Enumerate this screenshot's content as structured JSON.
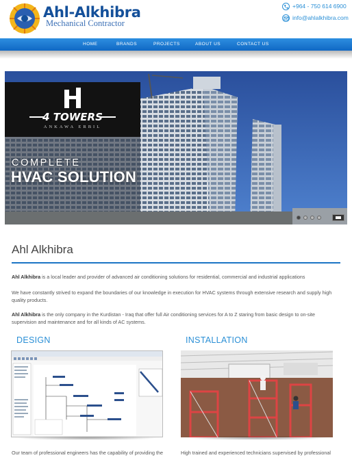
{
  "header": {
    "title": "Ahl-Alkhibra",
    "subtitle": "Mechanical Contractor",
    "phone": "+964 - 750 614 6900",
    "email": "info@ahlalkhibra.com",
    "brand_color": "#14509a",
    "accent_color": "#2a8fd6"
  },
  "nav": {
    "items": [
      {
        "label": "HOME"
      },
      {
        "label": "BRANDS"
      },
      {
        "label": "PROJECTS"
      },
      {
        "label": "ABOUT US"
      },
      {
        "label": "CONTACT US"
      }
    ],
    "bar_color": "#1a74c4"
  },
  "hero": {
    "brand_name": "4 TOWERS",
    "brand_location": "ANKAWA ERBIL",
    "line1": "COMPLETE",
    "line2": "HVAC SOLUTION",
    "slide_count": 4,
    "active_slide": 1
  },
  "about": {
    "title": "Ahl Alkhibra",
    "p1_lead": "Ahl Alkhibra",
    "p1_rest": " is a local leader and provider of advanced air conditioning solutions for residential, commercial and industrial applications",
    "p2": "We have constantly strived to expand the boundaries of our knowledge in execution for HVAC systems through extensive research and supply high quality products.",
    "p3_lead": "Ahl Alkhibra",
    "p3_rest": " is the only company in the Kurdistan - Iraq that offer full Air conditioning services for A to Z staring from basic design to on-site supervision and maintenance and for all kinds of AC systems."
  },
  "columns": [
    {
      "title": "DESIGN",
      "text": "Our team of professional engineers has the capability of providing the"
    },
    {
      "title": "INSTALLATION",
      "text": "High trained and experienced technicians supervised by professional"
    }
  ]
}
